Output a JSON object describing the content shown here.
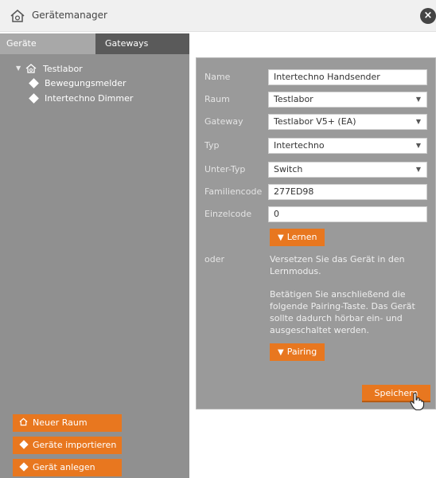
{
  "window": {
    "title": "Gerätemanager",
    "close_symbol": "×"
  },
  "tabs": [
    {
      "label": "Geräte",
      "active": true
    },
    {
      "label": "Gateways",
      "active": false
    }
  ],
  "tree": {
    "root": "Testlabor",
    "children": [
      "Bewegungsmelder",
      "Intertechno Dimmer"
    ]
  },
  "sidebar_buttons": {
    "new_room": "Neuer Raum",
    "import": "Geräte importieren",
    "create": "Gerät anlegen"
  },
  "form": {
    "name": {
      "label": "Name",
      "value": "Intertechno Handsender"
    },
    "raum": {
      "label": "Raum",
      "value": "Testlabor"
    },
    "gateway": {
      "label": "Gateway",
      "value": "Testlabor V5+ (EA)"
    },
    "typ": {
      "label": "Typ",
      "value": "Intertechno"
    },
    "untertyp": {
      "label": "Unter-Typ",
      "value": "Switch"
    },
    "familiencode": {
      "label": "Familiencode",
      "value": "277ED98"
    },
    "einzelcode": {
      "label": "Einzelcode",
      "value": "0"
    }
  },
  "learn_button": "Lernen",
  "oder_label": "oder",
  "instructions": {
    "line1": "Versetzen Sie das Gerät in den Lernmodus.",
    "line2": "Betätigen Sie anschließend die folgende Pairing-Taste. Das Gerät sollte dadurch hörbar ein- und ausgeschaltet werden."
  },
  "pairing_button": "Pairing",
  "save_button": "Speichern",
  "colors": {
    "accent": "#e8771f",
    "sidebar": "#909090",
    "panel": "#9a9a9a"
  }
}
